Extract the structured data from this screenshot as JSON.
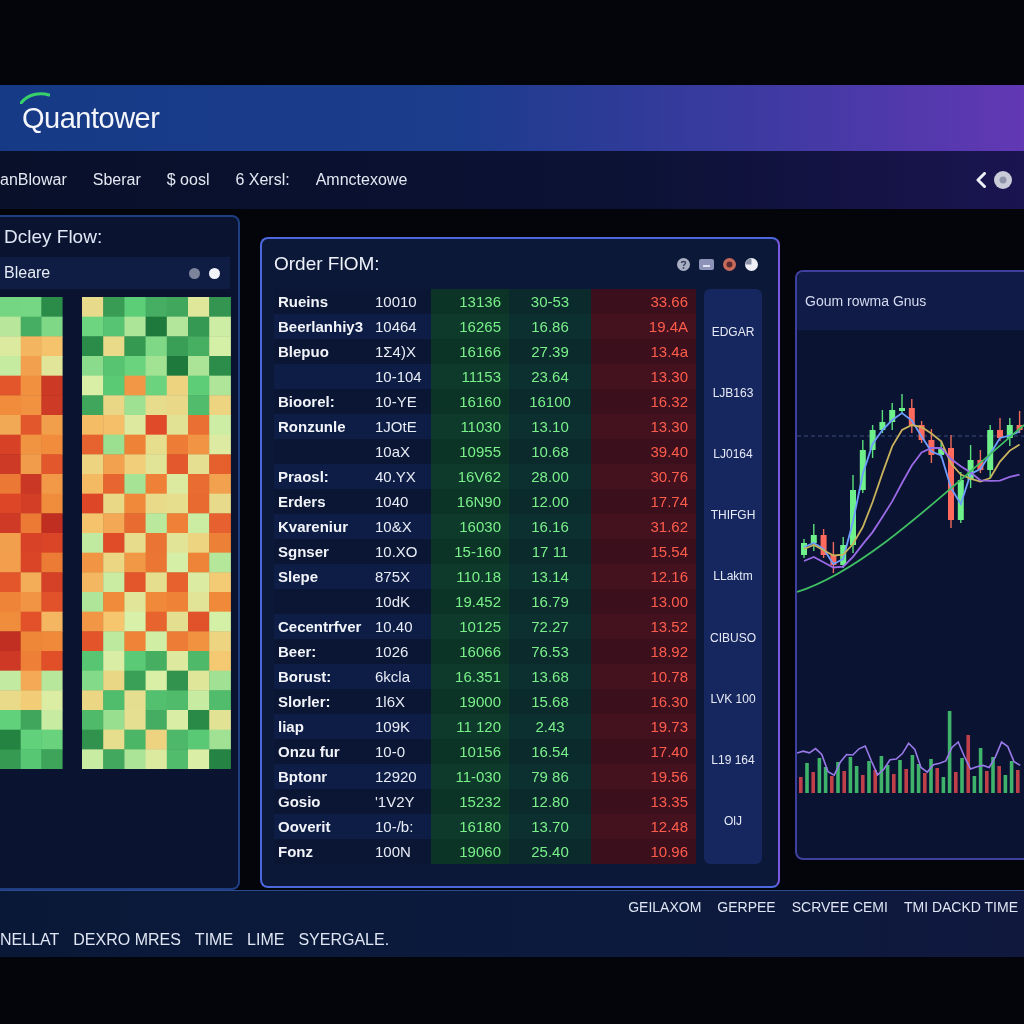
{
  "header": {
    "logo": "Quantower"
  },
  "nav": {
    "items": [
      "anBlowar",
      "Sberar",
      "$ oosl",
      "6 Xersl:",
      "Amnctexowe"
    ]
  },
  "left_panel": {
    "title": "Dcley Flow:",
    "subtitle": "Bleare"
  },
  "order_flow": {
    "title": "Order FlOM:",
    "rows": [
      {
        "label": "Rueins",
        "cells": [
          "10010",
          "13136",
          "30-53",
          "33.66"
        ]
      },
      {
        "label": "Beerlanhiy3",
        "cells": [
          "10464",
          "16265",
          "16.86",
          "19.4A"
        ]
      },
      {
        "label": "Blepuo",
        "cells": [
          "1Σ4)X",
          "16166",
          "27.39",
          "13.4a"
        ]
      },
      {
        "cells": [
          "10-104",
          "11153",
          "23.64",
          "13.30"
        ]
      },
      {
        "label": "Bioorel:",
        "cells": [
          "10-YE",
          "16160",
          "16100",
          "16.32"
        ]
      },
      {
        "label": "Ronzunle",
        "cells": [
          "1JOtE",
          "11030",
          "13.10",
          "13.30"
        ]
      },
      {
        "cells": [
          "10aX",
          "10955",
          "10.68",
          "39.40"
        ]
      },
      {
        "label": "Praosl:",
        "cells": [
          "40.YX",
          "16V62",
          "28.00",
          "30.76"
        ]
      },
      {
        "label": "Erders",
        "cells": [
          "1040",
          "16N90",
          "12.00",
          "17.74"
        ]
      },
      {
        "label": "Kvareniur",
        "cells": [
          "10&X",
          "16030",
          "16.16",
          "31.62"
        ]
      },
      {
        "label": "Sgnser",
        "cells": [
          "10.XO",
          "15-160",
          "17 11",
          "15.54"
        ]
      },
      {
        "label": "Slepe",
        "cells": [
          "875X",
          "110.18",
          "13.14",
          "12.16"
        ]
      },
      {
        "cells": [
          "10dK",
          "19.452",
          "16.79",
          "13.00"
        ]
      },
      {
        "label": "Cecentrfver",
        "cells": [
          "10.40",
          "10125",
          "72.27",
          "13.52"
        ]
      },
      {
        "label": "Beer:",
        "cells": [
          "1026",
          "16066",
          "76.53",
          "18.92"
        ]
      },
      {
        "label": "Borust:",
        "cells": [
          "6kcla",
          "16.351",
          "13.68",
          "10.78"
        ]
      },
      {
        "label": "Slorler:",
        "cells": [
          "1l6X",
          "19000",
          "15.68",
          "16.30"
        ]
      },
      {
        "label": "liap",
        "cells": [
          "109K",
          "11 120",
          "2.43",
          "19.73"
        ]
      },
      {
        "label": "Onzu fur",
        "cells": [
          "10-0",
          "10156",
          "16.54",
          "17.40"
        ]
      },
      {
        "label": "Bptonr",
        "cells": [
          "12920",
          "11-030",
          "79 86",
          "19.56"
        ]
      },
      {
        "label": "Gosio",
        "cells": [
          "'1V2Y",
          "15232",
          "12.80",
          "13.35"
        ]
      },
      {
        "label": "Ooverit",
        "cells": [
          "10-/b:",
          "16180",
          "13.70",
          "12.48"
        ]
      },
      {
        "label": "Fonz",
        "cells": [
          "100N",
          "19060",
          "25.40",
          "10.96"
        ]
      }
    ],
    "side_labels": [
      "EDGAR",
      "LJB163",
      "LJ0164",
      "THIFGH",
      "LLaktm",
      "CIBUSO",
      "LVK 100",
      "L19 164",
      "OlJ"
    ]
  },
  "chart_panel": {
    "title": "Goum rowma Gnus"
  },
  "status_bar": {
    "right_items": [
      "GEILAXOM",
      "GERPEE",
      "SCRVEE CEMI",
      "TMI DACKD TIME"
    ],
    "left_items": [
      "NELLAT",
      "DEXRO MRES",
      "TIME",
      "LIME",
      "SYERGALE."
    ]
  }
}
